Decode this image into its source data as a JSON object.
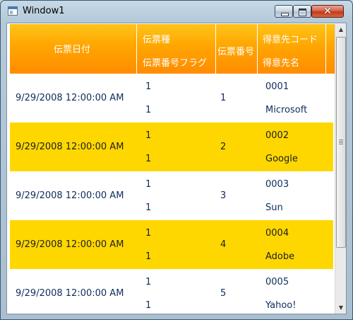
{
  "window": {
    "title": "Window1"
  },
  "window_controls": {
    "close_glyph": "✕"
  },
  "grid": {
    "columns": {
      "date": "伝票日付",
      "type_top": "伝票種",
      "type_bottom": "伝票番号フラグ",
      "number": "伝票番号",
      "cust_top": "得意先コード",
      "cust_bottom": "得意先名"
    },
    "rows": [
      {
        "date": "9/29/2008 12:00:00 AM",
        "type": "1",
        "flag": "1",
        "number": "1",
        "code": "0001",
        "name": "Microsoft"
      },
      {
        "date": "9/29/2008 12:00:00 AM",
        "type": "1",
        "flag": "1",
        "number": "2",
        "code": "0002",
        "name": "Google"
      },
      {
        "date": "9/29/2008 12:00:00 AM",
        "type": "1",
        "flag": "1",
        "number": "3",
        "code": "0003",
        "name": "Sun"
      },
      {
        "date": "9/29/2008 12:00:00 AM",
        "type": "1",
        "flag": "1",
        "number": "4",
        "code": "0004",
        "name": "Adobe"
      },
      {
        "date": "9/29/2008 12:00:00 AM",
        "type": "1",
        "flag": "1",
        "number": "5",
        "code": "0005",
        "name": "Yahoo!"
      }
    ],
    "row_colors": {
      "odd": "#ffffff",
      "even": "#ffd700"
    },
    "header_color": "#ffa500"
  },
  "scrollbar": {
    "up_glyph": "▲",
    "down_glyph": "▼"
  }
}
